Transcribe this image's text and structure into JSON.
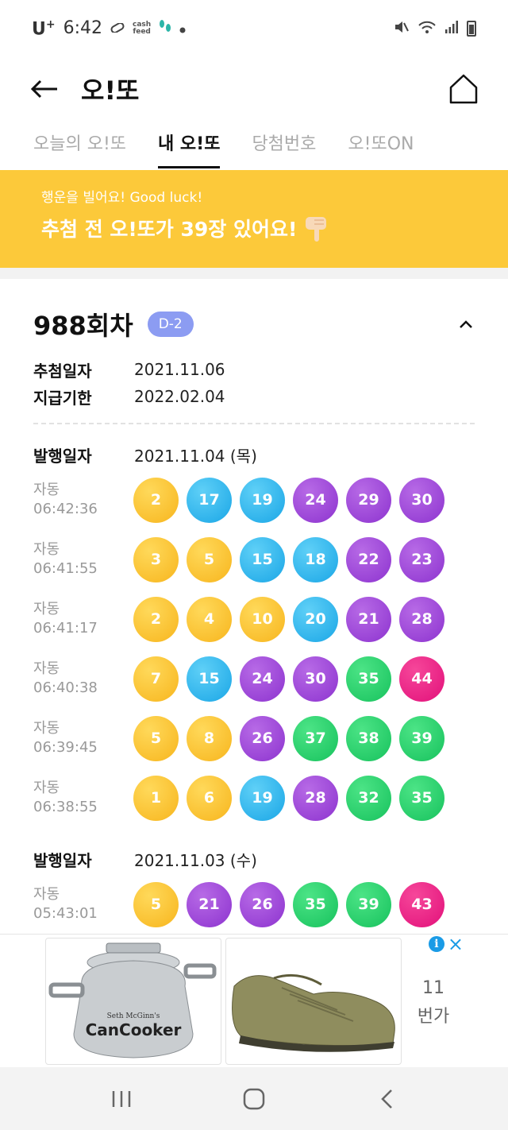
{
  "status_bar": {
    "carrier": "U",
    "carrier_sup": "+",
    "time": "6:42",
    "cashfeed_top": "cash",
    "cashfeed_bottom": "feed"
  },
  "app_bar": {
    "title": "오!또"
  },
  "tabs": [
    {
      "label": "오늘의 오!또",
      "active": false
    },
    {
      "label": "내 오!또",
      "active": true
    },
    {
      "label": "당첨번호",
      "active": false
    },
    {
      "label": "오!또ON",
      "active": false
    }
  ],
  "banner": {
    "subtitle": "행운을 빌어요! Good luck!",
    "message": "추첨 전 오!또가 39장 있어요!"
  },
  "round": {
    "title": "988회차",
    "dday": "D-2",
    "draw_date_label": "추첨일자",
    "draw_date": "2021.11.06",
    "payment_deadline_label": "지급기한",
    "payment_deadline": "2022.02.04"
  },
  "issues": [
    {
      "label": "발행일자",
      "date": "2021.11.04 (목)",
      "tickets": [
        {
          "mode": "자동",
          "time": "06:42:36",
          "numbers": [
            2,
            17,
            19,
            24,
            29,
            30
          ]
        },
        {
          "mode": "자동",
          "time": "06:41:55",
          "numbers": [
            3,
            5,
            15,
            18,
            22,
            23
          ]
        },
        {
          "mode": "자동",
          "time": "06:41:17",
          "numbers": [
            2,
            4,
            10,
            20,
            21,
            28
          ]
        },
        {
          "mode": "자동",
          "time": "06:40:38",
          "numbers": [
            7,
            15,
            24,
            30,
            35,
            44
          ]
        },
        {
          "mode": "자동",
          "time": "06:39:45",
          "numbers": [
            5,
            8,
            26,
            37,
            38,
            39
          ]
        },
        {
          "mode": "자동",
          "time": "06:38:55",
          "numbers": [
            1,
            6,
            19,
            28,
            32,
            35
          ]
        }
      ]
    },
    {
      "label": "발행일자",
      "date": "2021.11.03 (수)",
      "tickets": [
        {
          "mode": "자동",
          "time": "05:43:01",
          "numbers": [
            5,
            21,
            26,
            35,
            39,
            43
          ]
        }
      ]
    }
  ],
  "ball_colors": {
    "1-10": "#f7b51d",
    "11-20": "#1aa6e6",
    "21-30": "#8d33cf",
    "31-40": "#17c25d",
    "41-45": "#e2107a"
  },
  "ad": {
    "info_icon": "i",
    "close_icon": "×",
    "count": "11",
    "unit": "번가",
    "product1_brand": "CanCooker",
    "product1_script": "Seth McGinn's"
  },
  "nav": {
    "recents_icon": "recents-icon",
    "home_icon": "home-circle-icon",
    "back_icon": "back-chevron-icon"
  }
}
